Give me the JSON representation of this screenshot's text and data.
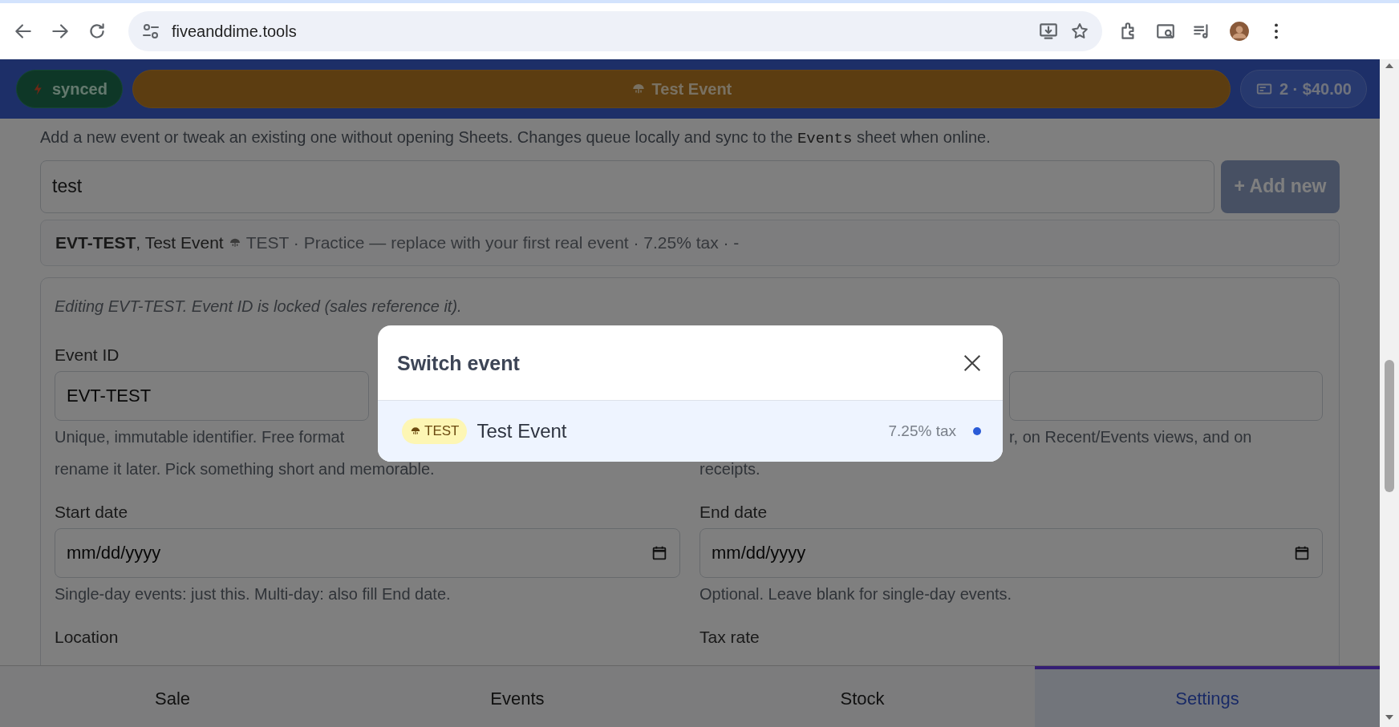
{
  "browser": {
    "url": "fiveanddime.tools"
  },
  "header": {
    "sync_status": "synced",
    "event": "Test Event",
    "cart": "2 · $40.00"
  },
  "intro": {
    "before": "Add a new event or tweak an existing one without opening Sheets. Changes queue locally and sync to the ",
    "code": "Events",
    "after": " sheet when online."
  },
  "search": {
    "value": "test"
  },
  "add_button": "+ Add new",
  "result": {
    "title": "**EVT-TEST**, Test Event",
    "details": "TEST · Practice — replace with your first real event · 7.25% tax · -"
  },
  "editor": {
    "note": "Editing EVT-TEST. Event ID is locked (sales reference it).",
    "event_id": {
      "label": "Event ID",
      "value": "EVT-TEST",
      "help": [
        "Unique, immutable identifier. Free format",
        "rename it later. Pick something short and memorable."
      ]
    },
    "display_name": {
      "help": [
        "r, on Recent/Events views, and on",
        "receipts."
      ]
    },
    "start_date": {
      "label": "Start date",
      "placeholder": "mm/dd/yyyy",
      "help": "Single-day events: just this. Multi-day: also fill End date."
    },
    "end_date": {
      "label": "End date",
      "placeholder": "mm/dd/yyyy",
      "help": "Optional. Leave blank for single-day events."
    },
    "location": {
      "label": "Location"
    },
    "tax_rate": {
      "label": "Tax rate"
    }
  },
  "modal": {
    "title": "Switch event",
    "events": [
      {
        "tag": "TEST",
        "name": "Test Event",
        "tax": "7.25% tax",
        "selected": true
      }
    ]
  },
  "nav": [
    {
      "label": "Sale",
      "selected": false
    },
    {
      "label": "Events",
      "selected": false
    },
    {
      "label": "Stock",
      "selected": false
    },
    {
      "label": "Settings",
      "selected": true
    }
  ]
}
